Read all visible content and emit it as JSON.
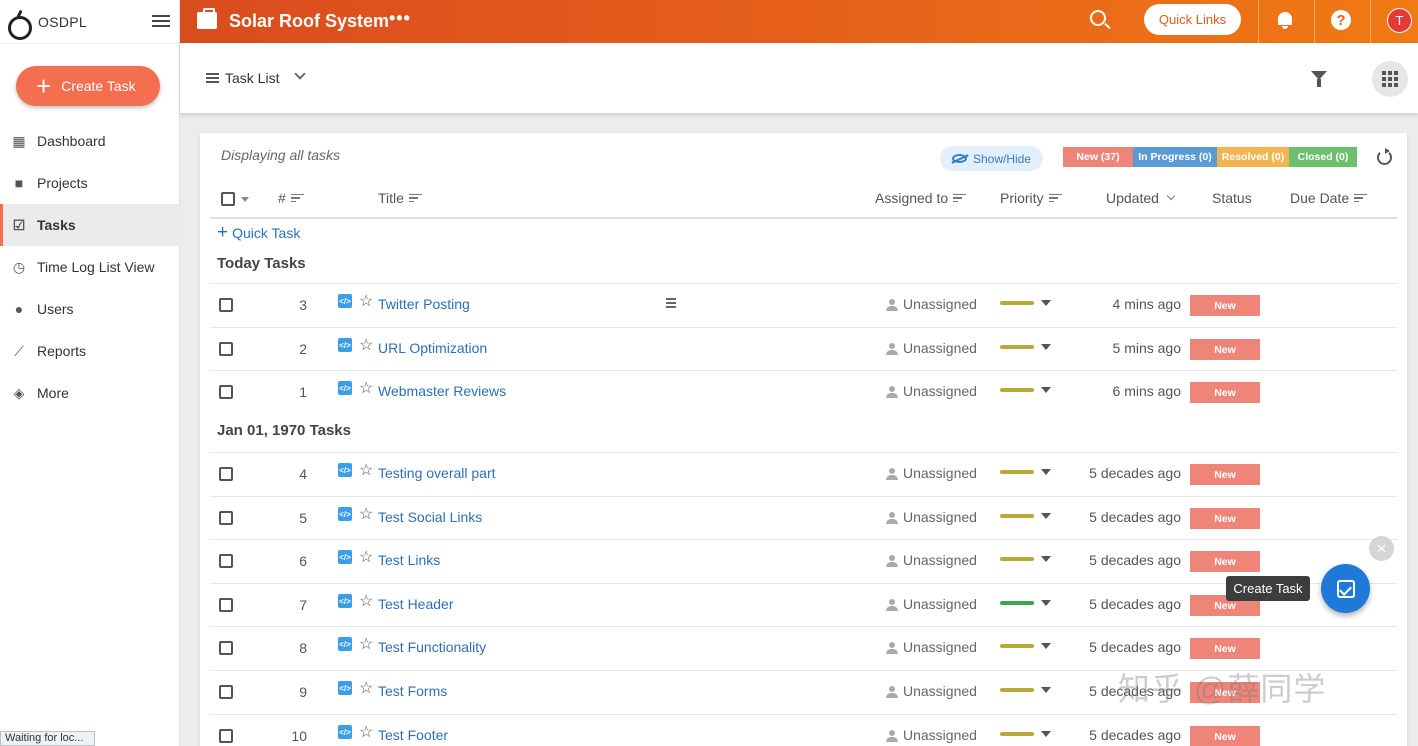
{
  "brand": {
    "name": "OSDPL"
  },
  "sidebar": {
    "create_label": "Create Task",
    "items": [
      {
        "label": "Dashboard",
        "icon": "dashboard-icon"
      },
      {
        "label": "Projects",
        "icon": "briefcase-icon"
      },
      {
        "label": "Tasks",
        "icon": "checkbox-icon",
        "active": true
      },
      {
        "label": "Time Log List View",
        "icon": "clock-icon"
      },
      {
        "label": "Users",
        "icon": "user-icon"
      },
      {
        "label": "Reports",
        "icon": "trend-icon"
      },
      {
        "label": "More",
        "icon": "layers-icon"
      }
    ]
  },
  "topbar": {
    "project_title": "Solar Roof System",
    "more": "•••",
    "quick_links": "Quick Links",
    "help": "?",
    "avatar_initial": "T",
    "accent": "#e8641a"
  },
  "subheader": {
    "view_label": "Task List"
  },
  "card": {
    "displaying": "Displaying all tasks",
    "show_hide": "Show/Hide",
    "status_pills": [
      {
        "label": "New (37)",
        "color": "#ef8579"
      },
      {
        "label": "In Progress (0)",
        "color": "#5b9bd5"
      },
      {
        "label": "Resolved (0)",
        "color": "#f3b452"
      },
      {
        "label": "Closed (0)",
        "color": "#6dbf6d"
      }
    ]
  },
  "table": {
    "headers": {
      "num": "#",
      "title": "Title",
      "assigned": "Assigned to",
      "priority": "Priority",
      "updated": "Updated",
      "status": "Status",
      "due": "Due Date"
    },
    "quick_task": "Quick Task"
  },
  "groups": [
    {
      "title": "Today Tasks",
      "rows": [
        {
          "num": "3",
          "title": "Twitter Posting",
          "assigned": "Unassigned",
          "priority_color": "#b7a93a",
          "updated": "4 mins ago",
          "status": "New",
          "subtask": true
        },
        {
          "num": "2",
          "title": "URL Optimization",
          "assigned": "Unassigned",
          "priority_color": "#b7a93a",
          "updated": "5 mins ago",
          "status": "New"
        },
        {
          "num": "1",
          "title": "Webmaster Reviews",
          "assigned": "Unassigned",
          "priority_color": "#b7a93a",
          "updated": "6 mins ago",
          "status": "New"
        }
      ]
    },
    {
      "title": "Jan 01, 1970 Tasks",
      "rows": [
        {
          "num": "4",
          "title": "Testing overall part",
          "assigned": "Unassigned",
          "priority_color": "#b7a93a",
          "updated": "5 decades ago",
          "status": "New"
        },
        {
          "num": "5",
          "title": "Test Social Links",
          "assigned": "Unassigned",
          "priority_color": "#b7a93a",
          "updated": "5 decades ago",
          "status": "New"
        },
        {
          "num": "6",
          "title": "Test Links",
          "assigned": "Unassigned",
          "priority_color": "#b7a93a",
          "updated": "5 decades ago",
          "status": "New"
        },
        {
          "num": "7",
          "title": "Test Header",
          "assigned": "Unassigned",
          "priority_color": "#3aa84a",
          "updated": "5 decades ago",
          "status": "New"
        },
        {
          "num": "8",
          "title": "Test Functionality",
          "assigned": "Unassigned",
          "priority_color": "#b7a93a",
          "updated": "5 decades ago",
          "status": "New"
        },
        {
          "num": "9",
          "title": "Test Forms",
          "assigned": "Unassigned",
          "priority_color": "#b7a93a",
          "updated": "5 decades ago",
          "status": "New"
        },
        {
          "num": "10",
          "title": "Test Footer",
          "assigned": "Unassigned",
          "priority_color": "#b7a93a",
          "updated": "5 decades ago",
          "status": "New"
        }
      ]
    }
  ],
  "fab": {
    "tooltip": "Create Task",
    "close": "×"
  },
  "status_bar": "Waiting for loc...",
  "watermark": "知乎 @薛同学"
}
